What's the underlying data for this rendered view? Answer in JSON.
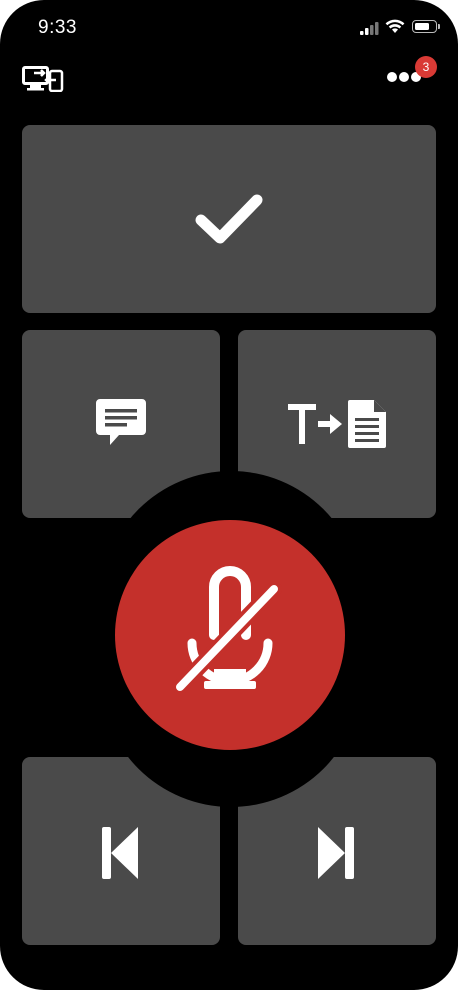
{
  "status_bar": {
    "time": "9:33",
    "signal_bars": 2,
    "battery_level": 0.75
  },
  "top_bar": {
    "left_icon": "screen-share-icon",
    "right_icon": "more-dots-icon",
    "notification_count": "3"
  },
  "controls": {
    "confirm_icon": "checkmark-icon",
    "comment_icon": "comment-icon",
    "transcribe_icon": "text-to-document-icon",
    "mic_icon": "microphone-muted-icon",
    "previous_icon": "skip-previous-icon",
    "next_icon": "skip-next-icon"
  },
  "colors": {
    "background": "#000000",
    "tile": "#4a4a4a",
    "mic_button": "#c4302b",
    "badge": "#d93a35",
    "icon": "#ffffff"
  }
}
